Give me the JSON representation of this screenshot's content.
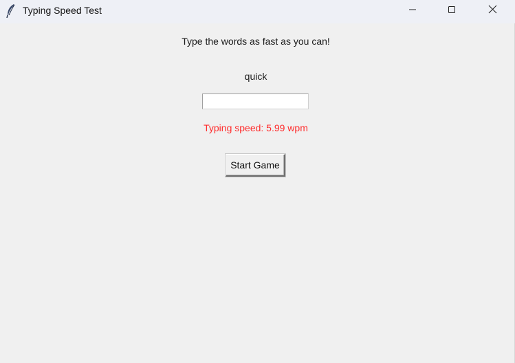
{
  "window": {
    "title": "Typing Speed Test"
  },
  "icons": {
    "app": "feather-icon",
    "minimize": "minimize-icon",
    "maximize": "maximize-icon",
    "close": "close-icon"
  },
  "game": {
    "instruction": "Type the words as fast as you can!",
    "current_word": "quick",
    "input_value": "",
    "speed_text": "Typing speed: 5.99 wpm",
    "start_button_label": "Start Game"
  },
  "colors": {
    "background": "#f0f0f0",
    "titlebar": "#eef0f6",
    "speed_text": "#ff2b2b"
  }
}
